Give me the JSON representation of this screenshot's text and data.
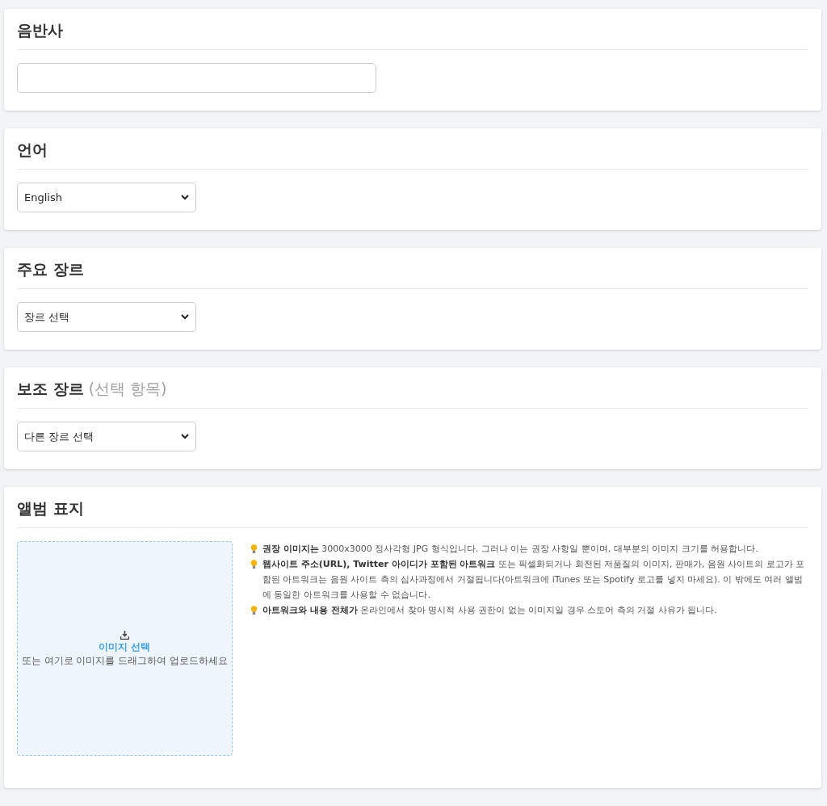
{
  "sections": [
    {
      "kind": "text",
      "title": "음반사"
    },
    {
      "kind": "select",
      "title": "언어",
      "value": "English"
    },
    {
      "kind": "select",
      "title": "주요 장르",
      "value": "장르 선택"
    },
    {
      "kind": "select",
      "title": "보조 장르",
      "note": "(선택 항목)",
      "value": "다른 장르 선택"
    },
    {
      "kind": "upload",
      "title": "앨범 표지",
      "upload_link": "이미지 선택",
      "upload_hint": "또는 여기로 이미지를 드래그하여 업로드하세요",
      "tips": [
        "**권장 이미지는** 3000x3000 정사각형 JPG 형식입니다. 그러나 이는 권장 사항일 뿐이며, 대부분의 이미지 크기를 허용합니다.",
        "**웹사이트 주소(URL), Twitter 아이디가 포함된 아트워크** 또는 픽셀화되거나 회전된 저품질의 이미지, 판매가, 음원 사이트의 로고가 포함된 아트워크는 음원 사이트 측의 심사과정에서 거절됩니다(아트워크에 iTunes 또는 Spotify 로고를 넣지 마세요). 이 밖에도 여러 앨범에 동일한 아트워크를 사용할 수 없습니다.",
        "**아트워크와 내용 전체가** 온라인에서 찾아 명시적 사용 권한이 없는 이미지일 경우 스토어 측의 거절 사유가 됩니다."
      ]
    }
  ]
}
